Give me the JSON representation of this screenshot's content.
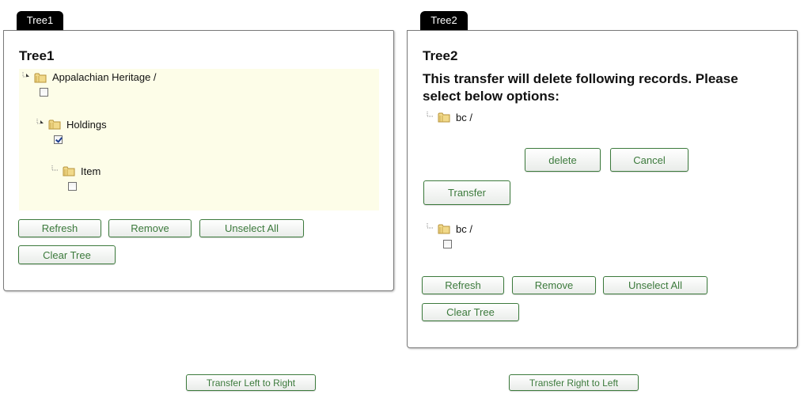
{
  "tree1": {
    "tab": "Tree1",
    "title": "Tree1",
    "nodes": [
      {
        "label": "Appalachian Heritage /",
        "checked": false
      },
      {
        "label": "Holdings",
        "checked": true
      },
      {
        "label": "Item",
        "checked": false
      }
    ],
    "buttons": {
      "refresh": "Refresh",
      "remove": "Remove",
      "unselect_all": "Unselect All",
      "clear_tree": "Clear Tree"
    }
  },
  "tree2": {
    "tab": "Tree2",
    "title": "Tree2",
    "message": "This transfer will delete following records. Please select below options:",
    "delete_preview_node": {
      "label": "bc /"
    },
    "delete_button": "delete",
    "cancel_button": "Cancel",
    "transfer_button": "Transfer",
    "nodes": [
      {
        "label": "bc /",
        "checked": false
      }
    ],
    "buttons": {
      "refresh": "Refresh",
      "remove": "Remove",
      "unselect_all": "Unselect All",
      "clear_tree": "Clear Tree"
    }
  },
  "footer": {
    "transfer_left_to_right": "Transfer Left to Right",
    "transfer_right_to_left": "Transfer Right to Left"
  },
  "colors": {
    "button_text": "#3c7a3c",
    "button_border": "#3c7a3c",
    "tree_highlight": "#fdfde8",
    "tab_bg": "#000000"
  },
  "icons": {
    "folder": "folder-icon",
    "expander": "tree-expander-icon"
  }
}
